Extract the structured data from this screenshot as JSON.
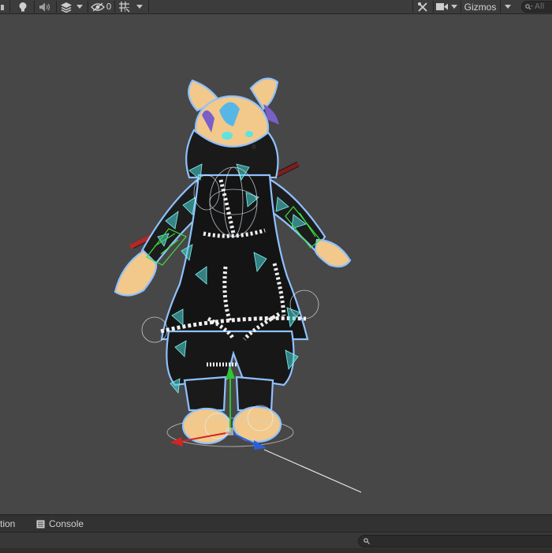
{
  "toolbar": {
    "lighting_icon": "lightbulb-icon",
    "audio_icon": "speaker-icon",
    "effects_icon": "layers-icon",
    "hidden_count": "0",
    "gizmos_label": "Gizmos",
    "search_placeholder": "All"
  },
  "bottom_panel": {
    "tab_partial_label": "tion",
    "console_label": "Console",
    "console_search_placeholder": ""
  },
  "colors": {
    "scene_bg": "#474747",
    "toolbar_bg": "#3c3c3c",
    "selection_outline": "#8fc1ff",
    "collider_cyan": "#4fd8d8",
    "bone_green": "#3fdc3f",
    "fur": "#f2c98a",
    "axis_x": "#d22424",
    "axis_y": "#2fc52f",
    "axis_z": "#2c5fdc"
  }
}
